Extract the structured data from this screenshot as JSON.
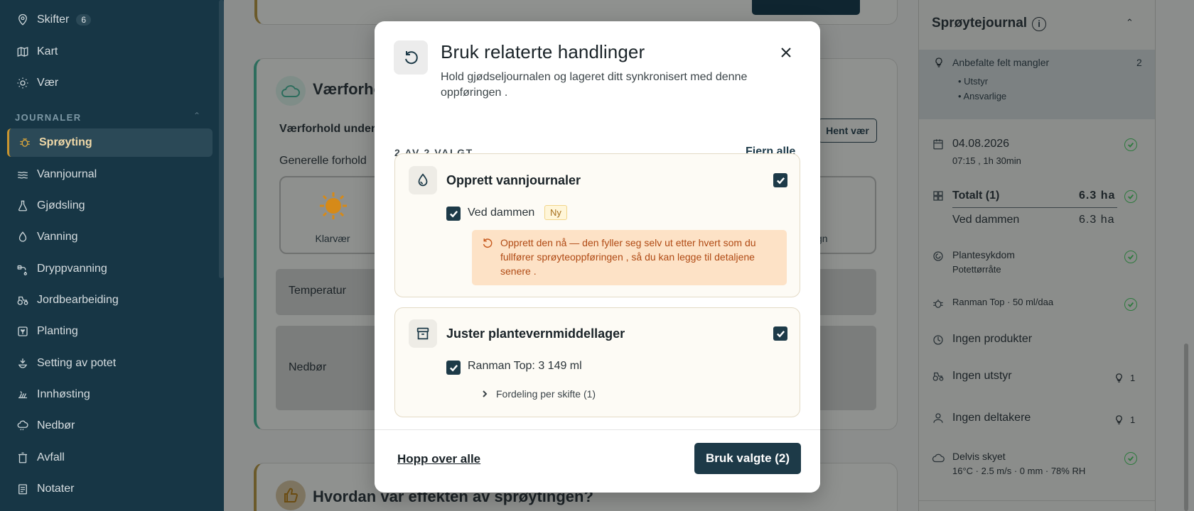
{
  "sidebar": {
    "items": [
      {
        "label": "Skifter",
        "badge": "6",
        "icon": "location-pin-icon"
      },
      {
        "label": "Kart",
        "icon": "map-icon"
      },
      {
        "label": "Vær",
        "icon": "sun-icon"
      },
      {
        "label": "Sprøyting",
        "icon": "bug-icon",
        "active": true
      },
      {
        "label": "Vannjournal",
        "icon": "waves-icon"
      },
      {
        "label": "Gjødsling",
        "icon": "flask-icon"
      },
      {
        "label": "Vanning",
        "icon": "droplet-icon"
      },
      {
        "label": "Dryppvanning",
        "icon": "drip-icon"
      },
      {
        "label": "Jordbearbeiding",
        "icon": "tractor-icon"
      },
      {
        "label": "Planting",
        "icon": "plant-icon"
      },
      {
        "label": "Setting av potet",
        "icon": "potato-icon"
      },
      {
        "label": "Innhøsting",
        "icon": "harvest-icon"
      },
      {
        "label": "Nedbør",
        "icon": "rain-cloud-icon"
      },
      {
        "label": "Avfall",
        "icon": "trash-icon"
      },
      {
        "label": "Notater",
        "icon": "notes-icon"
      }
    ],
    "section_label": "JOURNALER"
  },
  "main": {
    "weather_title": "Værforho",
    "weather_under": "Værforhold under",
    "general": "Generelle forhold",
    "klarvaer": "Klarvær",
    "regn": "gn",
    "hent_vaer": "Hent vær",
    "temperatur": "Temperatur",
    "nedbor": "Nedbør",
    "effect_title": "Hvordan var effekten av sprøytingen?"
  },
  "right_panel": {
    "title": "Sprøytejournal",
    "warn_label": "Anbefalte felt mangler",
    "warn_count": "2",
    "warn_items": [
      "Utstyr",
      "Ansvarlige"
    ],
    "date": "04.08.2026",
    "time": "07:15 ,  1h 30min",
    "total_label": "Totalt (1)",
    "total_value": "6.3 ha",
    "field_label": "Ved dammen",
    "field_value": "6.3 ha",
    "disease_label": "Plantesykdom",
    "disease_value": "Potettørråte",
    "product": "Ranman Top · 50 ml/daa",
    "no_products": "Ingen produkter",
    "no_equipment": "Ingen utstyr",
    "no_equipment_count": "1",
    "no_participants": "Ingen deltakere",
    "no_participants_count": "1",
    "weather_label": "Delvis skyet",
    "weather_value": "16°C · 2.5 m/s · 0 mm · 78% RH"
  },
  "modal": {
    "title": "Bruk relaterte handlinger",
    "subtitle": "Hold gjødseljournalen og lageret ditt synkronisert med denne oppføringen .",
    "count": "2 AV 2 VALGT",
    "clear_all": "Fjern alle",
    "group1": {
      "title": "Opprett vannjournaler",
      "item": "Ved dammen",
      "badge": "Ny",
      "note": "Opprett den nå — den fyller seg selv ut etter hvert som du fullfører sprøyteoppføringen ,  så du kan legge til detaljene senere ."
    },
    "group2": {
      "title": "Juster plantevernmiddellager",
      "item": "Ranman Top: 3 149 ml",
      "expander": "Fordeling per skifte (1)"
    },
    "skip_all": "Hopp over alle",
    "apply": "Bruk valgte (2)"
  }
}
